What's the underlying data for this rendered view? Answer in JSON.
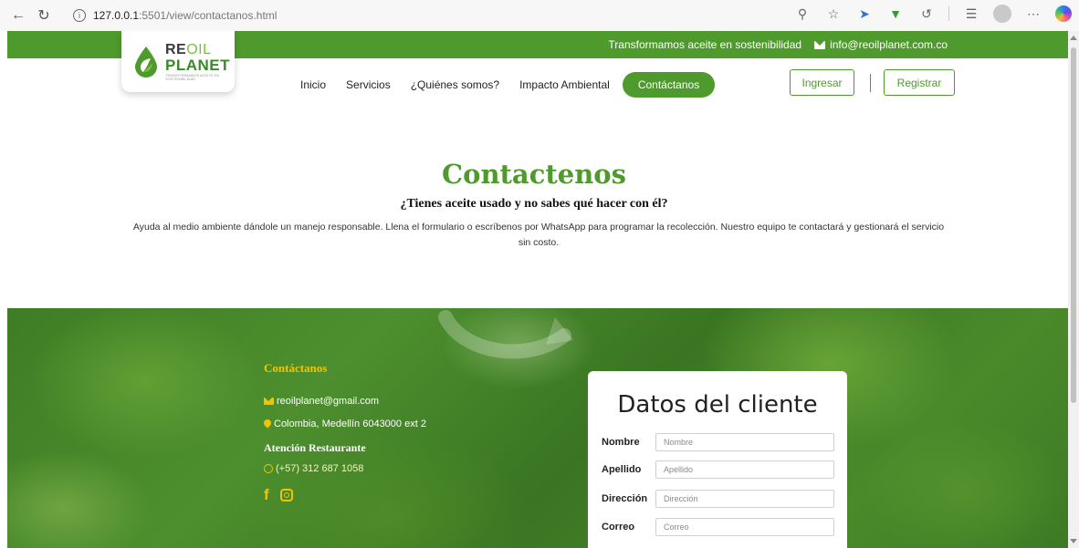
{
  "browser": {
    "url_host": "127.0.0.1",
    "url_path": ":5501/view/contactanos.html"
  },
  "topbar": {
    "slogan": "Transformamos aceite en sostenibilidad",
    "email": "info@reoilplanet.com.co"
  },
  "logo": {
    "re": "RE",
    "oil": "OIL",
    "planet": "PLANET",
    "tagline": "TRANSFORMAMOS ACEITE EN SOSTENIBILIDAD"
  },
  "nav": {
    "items": [
      "Inicio",
      "Servicios",
      "¿Quiénes somos?",
      "Impacto Ambiental"
    ],
    "active": "Contáctanos"
  },
  "auth": {
    "login": "Ingresar",
    "register": "Registrar"
  },
  "hero": {
    "title": "Contactenos",
    "subtitle": "¿Tienes aceite usado y no sabes qué hacer con él?",
    "description": "Ayuda al medio ambiente dándole un manejo responsable. Llena el formulario o escríbenos por WhatsApp para programar la recolección. Nuestro equipo te contactará y gestionará el servicio sin costo."
  },
  "contact": {
    "title": "Contáctanos",
    "email": "reoilplanet@gmail.com",
    "address": "Colombia, Medellín 6043000 ext 2",
    "attention_title": "Atención Restaurante",
    "whatsapp": "(+57) 312 687 1058"
  },
  "form": {
    "title": "Datos del cliente",
    "fields": [
      {
        "label": "Nombre",
        "placeholder": "Nombre"
      },
      {
        "label": "Apellido",
        "placeholder": "Apellido"
      },
      {
        "label": "Dirección",
        "placeholder": "Dirección"
      },
      {
        "label": "Correo",
        "placeholder": "Correo"
      }
    ]
  },
  "colors": {
    "brand_green": "#4f9a2c",
    "accent_yellow": "#f2c400"
  }
}
